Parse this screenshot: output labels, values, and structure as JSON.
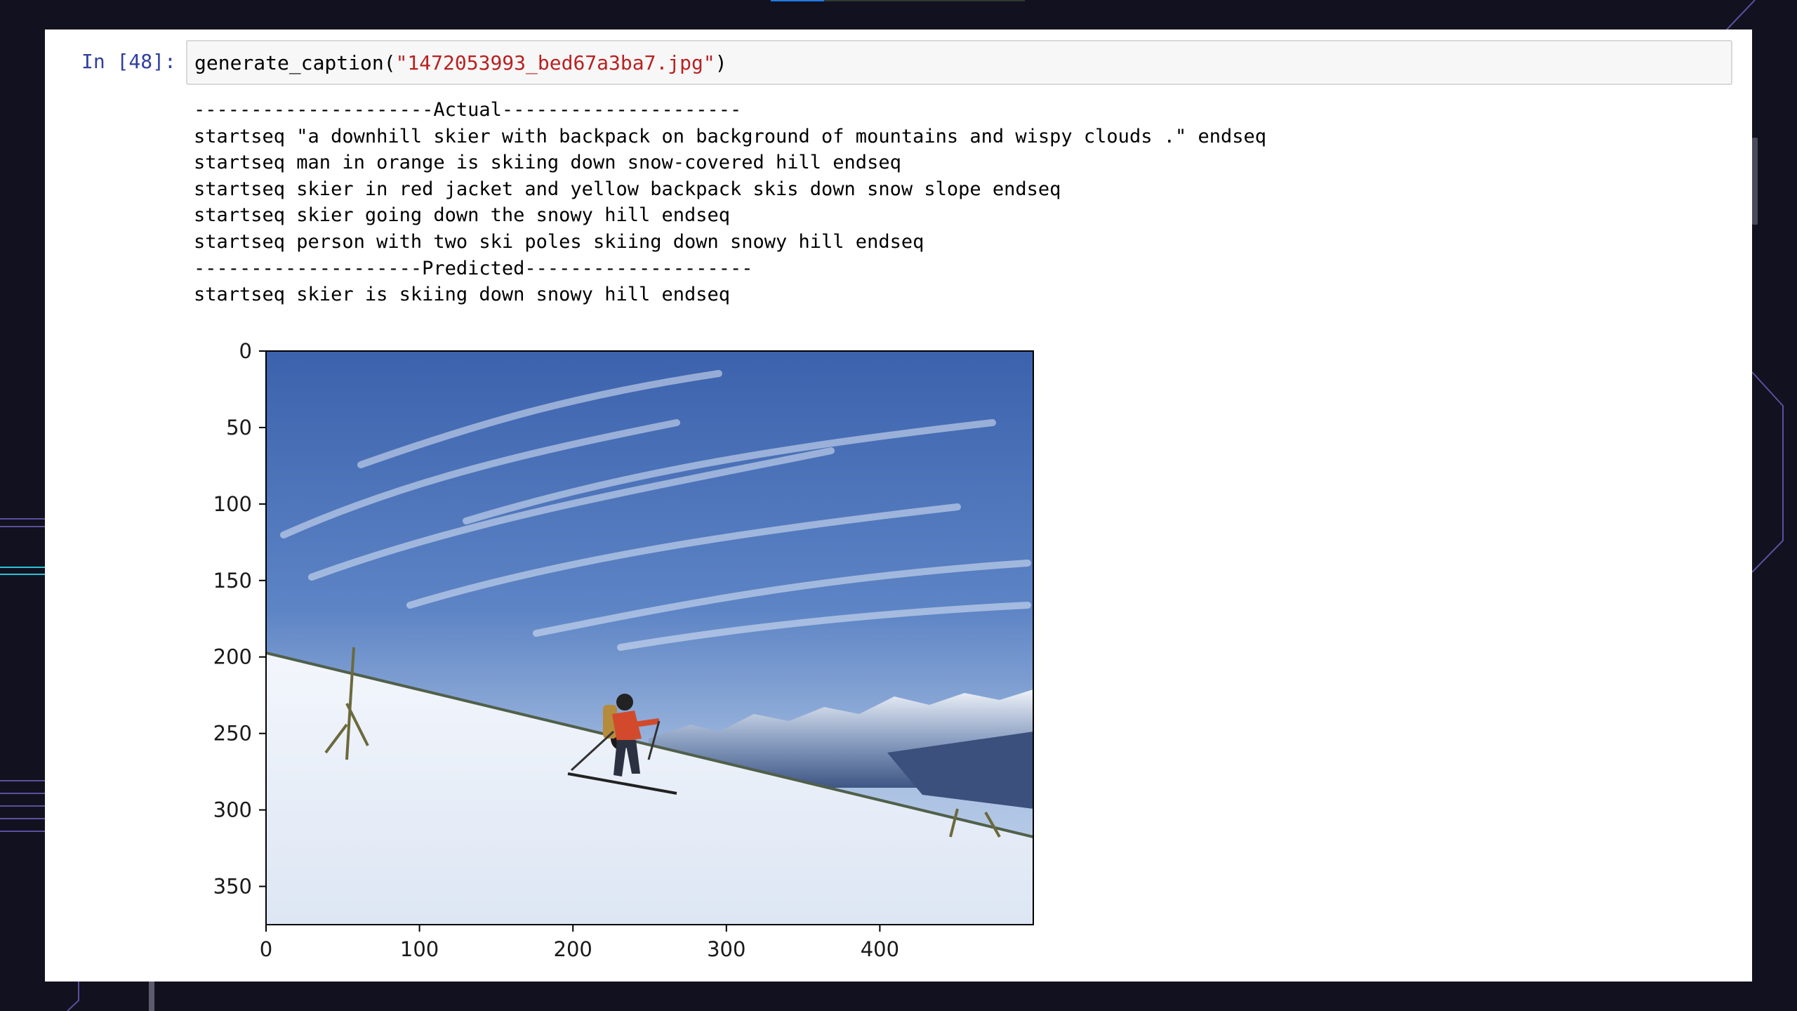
{
  "cell": {
    "prompt": "In [48]:",
    "code_fn": "generate_caption(",
    "code_arg": "\"1472053993_bed67a3ba7.jpg\"",
    "code_close": ")"
  },
  "output": {
    "actual_header": "---------------------Actual---------------------",
    "actual": [
      "startseq \"a downhill skier with backpack on background of mountains and wispy clouds .\" endseq",
      "startseq man in orange is skiing down snow-covered hill endseq",
      "startseq skier in red jacket and yellow backpack skis down snow slope endseq",
      "startseq skier going down the snowy hill endseq",
      "startseq person with two ski poles skiing down snowy hill endseq"
    ],
    "predicted_header": "--------------------Predicted--------------------",
    "predicted": "startseq skier is skiing down snowy hill endseq"
  },
  "plot": {
    "image_description_icon": "skier-on-snowy-slope-photo",
    "y_ticks": [
      "0",
      "50",
      "100",
      "150",
      "200",
      "250",
      "300",
      "350"
    ],
    "x_ticks": [
      "0",
      "100",
      "200",
      "300",
      "400"
    ],
    "x_range": [
      0,
      500
    ],
    "y_range": [
      0,
      375
    ]
  },
  "colors": {
    "background": "#12111f",
    "prompt": "#303f9f",
    "string": "#ba2121",
    "sky": "#4a6fb5",
    "snow": "#e6edf7"
  }
}
